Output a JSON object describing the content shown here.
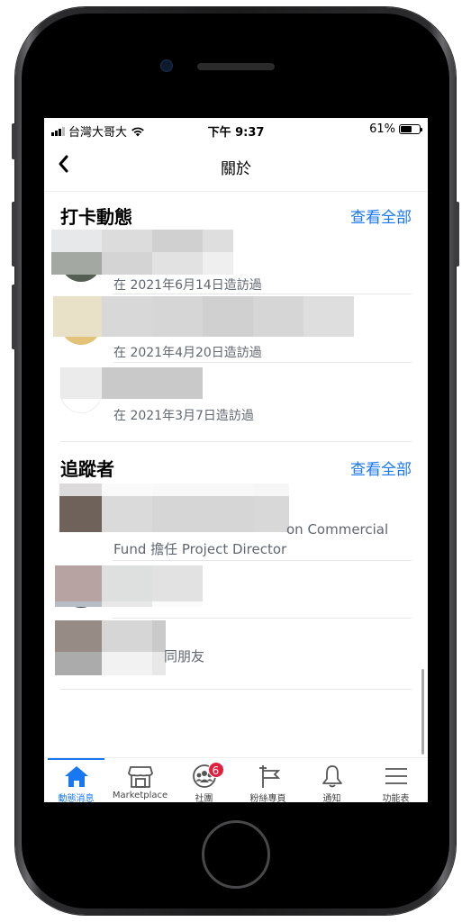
{
  "status_bar": {
    "carrier": "台灣大哥大",
    "time": "下午 9:37",
    "battery_percent": "61%",
    "battery_level": 0.61
  },
  "nav": {
    "back_icon": "chevron-left-icon",
    "title": "關於"
  },
  "checkins": {
    "title": "打卡動態",
    "see_all": "查看全部",
    "items": [
      {
        "name": "",
        "subtitle": "在 2021年6月14日造訪過"
      },
      {
        "name": "",
        "subtitle": "在 2021年4月20日造訪過"
      },
      {
        "name": "",
        "subtitle": "在 2021年3月7日造訪過"
      }
    ]
  },
  "followers": {
    "title": "追蹤者",
    "see_all": "查看全部",
    "items": [
      {
        "line1_visible": "on Commercial",
        "line2": "Fund 擔任 Project Director"
      },
      {
        "line1_visible": ""
      },
      {
        "line1_visible": "同朋友"
      }
    ]
  },
  "tabs": [
    {
      "label": "動態消息",
      "icon": "home-icon",
      "active": true
    },
    {
      "label": "Marketplace",
      "icon": "storefront-icon",
      "active": false
    },
    {
      "label": "社團",
      "icon": "groups-icon",
      "active": false,
      "badge": "6"
    },
    {
      "label": "粉絲專頁",
      "icon": "flag-icon",
      "active": false
    },
    {
      "label": "通知",
      "icon": "bell-icon",
      "active": false
    },
    {
      "label": "功能表",
      "icon": "menu-icon",
      "active": false
    }
  ],
  "colors": {
    "accent": "#1877f2",
    "badge": "#e41e3f",
    "secondary_text": "#606770"
  }
}
